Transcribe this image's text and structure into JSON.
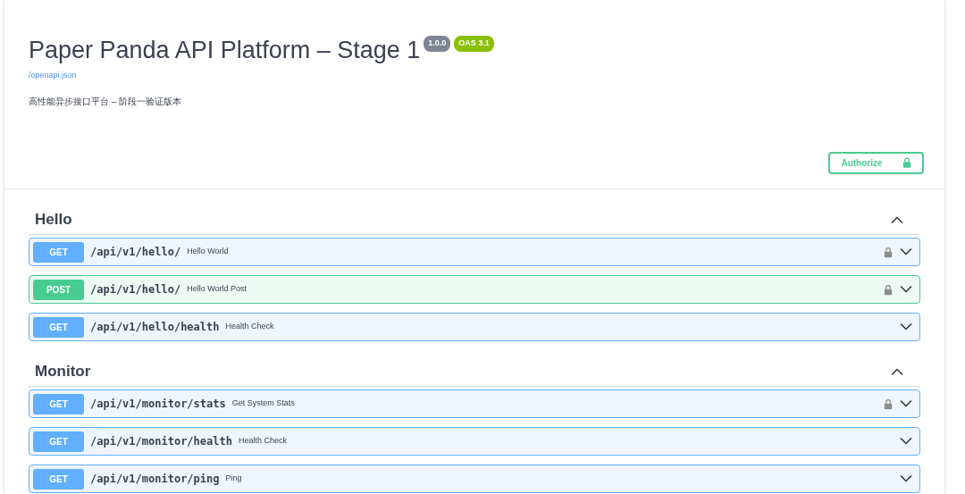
{
  "header": {
    "title": "Paper Panda API Platform – Stage 1",
    "version": "1.0.0",
    "oas": "OAS 3.1",
    "spec_link": "/openapi.json",
    "description": "高性能异步接口平台 – 阶段一验证版本",
    "authorize_button": "Authorize"
  },
  "sections": [
    {
      "name": "Hello",
      "expanded": true,
      "operations": [
        {
          "method": "GET",
          "path": "/api/v1/hello/",
          "summary": "Hello World",
          "secured": true
        },
        {
          "method": "POST",
          "path": "/api/v1/hello/",
          "summary": "Hello World Post",
          "secured": true
        },
        {
          "method": "GET",
          "path": "/api/v1/hello/health",
          "summary": "Health Check",
          "secured": false
        }
      ]
    },
    {
      "name": "Monitor",
      "expanded": true,
      "operations": [
        {
          "method": "GET",
          "path": "/api/v1/monitor/stats",
          "summary": "Get System Stats",
          "secured": true
        },
        {
          "method": "GET",
          "path": "/api/v1/monitor/health",
          "summary": "Health Check",
          "secured": false
        },
        {
          "method": "GET",
          "path": "/api/v1/monitor/ping",
          "summary": "Ping",
          "secured": false
        }
      ]
    }
  ]
}
